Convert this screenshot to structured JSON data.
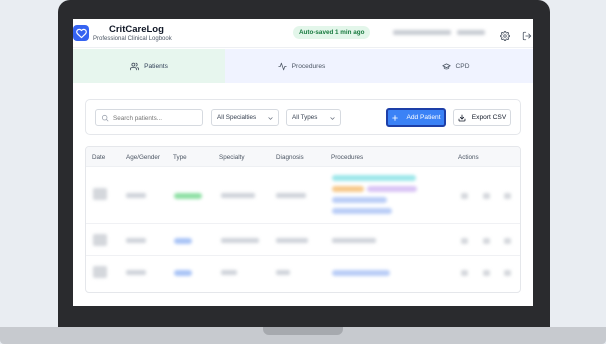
{
  "app": {
    "title": "CritCareLog",
    "subtitle": "Professional Clinical Logbook",
    "autosave": "Auto-saved 1 min ago",
    "brand_color": "#3563f1"
  },
  "tabs": [
    {
      "label": "Patients",
      "icon": "users-icon",
      "active": true
    },
    {
      "label": "Procedures",
      "icon": "activity-icon",
      "active": false
    },
    {
      "label": "CPD",
      "icon": "graduation-cap-icon",
      "active": false
    }
  ],
  "toolbar": {
    "search_placeholder": "Search patients...",
    "specialty_filter": "All Specialties",
    "type_filter": "All Types",
    "add_label": "Add Patient",
    "export_label": "Export CSV"
  },
  "table": {
    "headers": [
      "Date",
      "Age/Gender",
      "Type",
      "Specialty",
      "Diagnosis",
      "Procedures",
      "Actions"
    ]
  },
  "colors": {
    "autosave_bg": "#e3f6ea",
    "autosave_text": "#187a3f",
    "add_button": "#3b82f6",
    "active_tab_bg": "#e7f6ee",
    "tabs_bg": "#f0f3ff"
  }
}
